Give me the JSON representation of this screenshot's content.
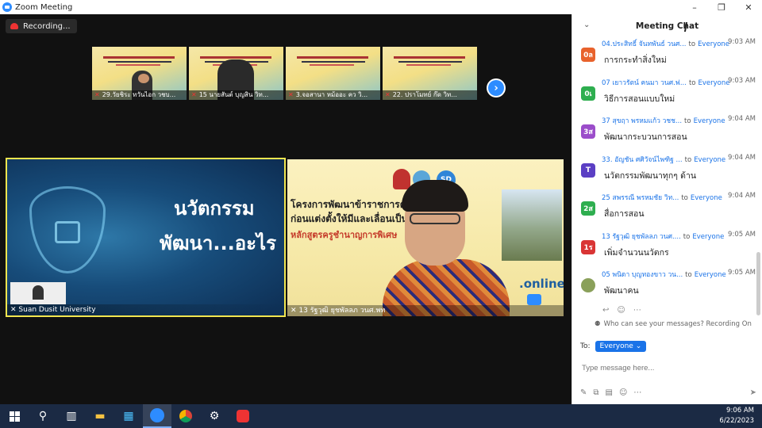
{
  "window": {
    "title": "Zoom Meeting",
    "controls": [
      "–",
      "❐",
      "✕"
    ]
  },
  "recording": {
    "label": "Recording..."
  },
  "thumbnails": [
    {
      "name": "29.วัยชิระ ทวันไอก วชบ..."
    },
    {
      "name": "15 นายสันต์ บุญสิน วิท..."
    },
    {
      "name": "3.จอสานา หม้ออะ คว วิ..."
    },
    {
      "name": "22. ปราโมทย์ ก๊ด วิท..."
    }
  ],
  "tile_left": {
    "line1": "นวัตกรรม",
    "line2": "พัฒนา...อะไร",
    "name": "Suan Dusit University"
  },
  "tile_right": {
    "heading1": "โครงการพัฒนาข้าราชการครู                   การศึกษา",
    "heading2": "ก่อนแต่งตั้งให้มีและเลื่อนเป็น",
    "heading3": "หลักสูตรครูชำนาญการพิเศษ",
    "online": ".online",
    "name": "13 รัฐวุฒิ ยุชพัลลภ วนศ.พท"
  },
  "chat": {
    "title": "Meeting Chat",
    "messages": [
      {
        "sender": "04.ประสิทธิ์ จันทพันธ์ วนศ...",
        "to": "to",
        "recipient": "Everyone",
        "time": "9:03 AM",
        "text": "การกระทำสิ่งใหม่",
        "avatar": "0ล",
        "color": "#e8622c"
      },
      {
        "sender": "07 เยาวรัตน์ คนมา วนศ.ฟ...",
        "to": "to",
        "recipient": "Everyone",
        "time": "9:03 AM",
        "text": "วิธีการสอนแบบใหม่",
        "avatar": "0เ",
        "color": "#2eae4f"
      },
      {
        "sender": "37 สุขฤา พรหมแก้ว วชช...",
        "to": "to",
        "recipient": "Everyone",
        "time": "9:04 AM",
        "text": "พัฒนากระบวนการสอน",
        "avatar": "3ส",
        "color": "#9b4dca"
      },
      {
        "sender": "33. อัญชัน ศศิวัจน์ไพฑิฐ ...",
        "to": "to",
        "recipient": "Everyone",
        "time": "9:04 AM",
        "text": "นวัตกรรมพัฒนาทุกๆ ด้าน",
        "avatar": "T",
        "color": "#5b3fc4"
      },
      {
        "sender": "25 สพรรณี พรหมชัย วิท...",
        "to": "to",
        "recipient": "Everyone",
        "time": "9:04 AM",
        "text": "สื่อการสอน",
        "avatar": "2ส",
        "color": "#2eae4f"
      },
      {
        "sender": "13 รัฐวุฒิ ยุชพัลลภ วนศ....",
        "to": "to",
        "recipient": "Everyone",
        "time": "9:05 AM",
        "text": "เพิ่มจำนวนนวัตกร",
        "avatar": "1ร",
        "color": "#d93535"
      },
      {
        "sender": "05 พนิดา บุญทองขาว วน...",
        "to": "to",
        "recipient": "Everyone",
        "time": "9:05 AM",
        "text": "พัฒนาคน",
        "avatar": "",
        "color": "#8aa05a"
      }
    ],
    "notice": "Who can see your messages? Recording On",
    "to_label": "To:",
    "to_value": "Everyone",
    "placeholder": "Type message here..."
  },
  "taskbar": {
    "time": "9:06 AM",
    "date": "6/22/2023"
  }
}
